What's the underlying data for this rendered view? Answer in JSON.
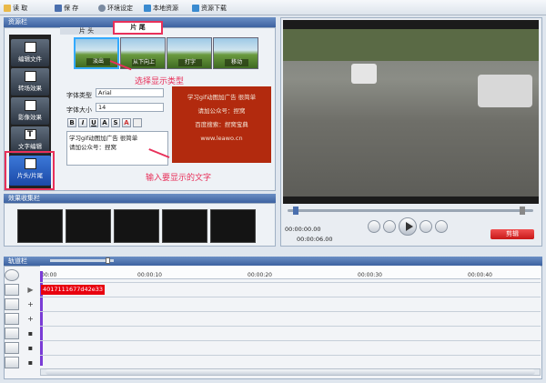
{
  "toolbar": {
    "read": "读 取",
    "save": "保 存",
    "env": "环境设定",
    "local": "本地资源",
    "download": "资源下载"
  },
  "resource": {
    "title": "资源栏",
    "tabs": [
      "片 头",
      "片 尾"
    ],
    "side": [
      "编辑文件",
      "转场效果",
      "影像效果",
      "文字编辑",
      "片头/片尾"
    ],
    "thumbs": [
      "淡出",
      "从下向上",
      "打字",
      "移动"
    ]
  },
  "font": {
    "type_label": "字体类型",
    "type_value": "Arial",
    "size_label": "字体大小",
    "size_value": "14",
    "style_btns": [
      "B",
      "I",
      "U",
      "A",
      "S",
      "A"
    ],
    "text_line1": "学习gif动图加广告 很简单",
    "text_line2": "请加公众号：捏窝"
  },
  "preview": {
    "line1": "学习gif动图加广告 很简单",
    "line2": "请加公众号：捏窝",
    "line3": "百度搜索：捏窝宝典",
    "line4": "www.leawo.cn"
  },
  "annotations": {
    "select": "选择显示类型",
    "input": "输入要显示的文字"
  },
  "effects": {
    "title": "效果收集栏"
  },
  "player": {
    "time_current": "00:00:00.00",
    "time_total": "00:00:06.00",
    "clip": "剪辑"
  },
  "timeline": {
    "title": "轨道栏",
    "ticks": [
      "00:00",
      "00:00:10",
      "00:00:20",
      "00:00:30",
      "00:00:40"
    ],
    "clip": "4017111677d42e33"
  },
  "colors": {
    "accent": "#e8305a",
    "header": "#4a6fae",
    "clip": "#e8000e"
  }
}
